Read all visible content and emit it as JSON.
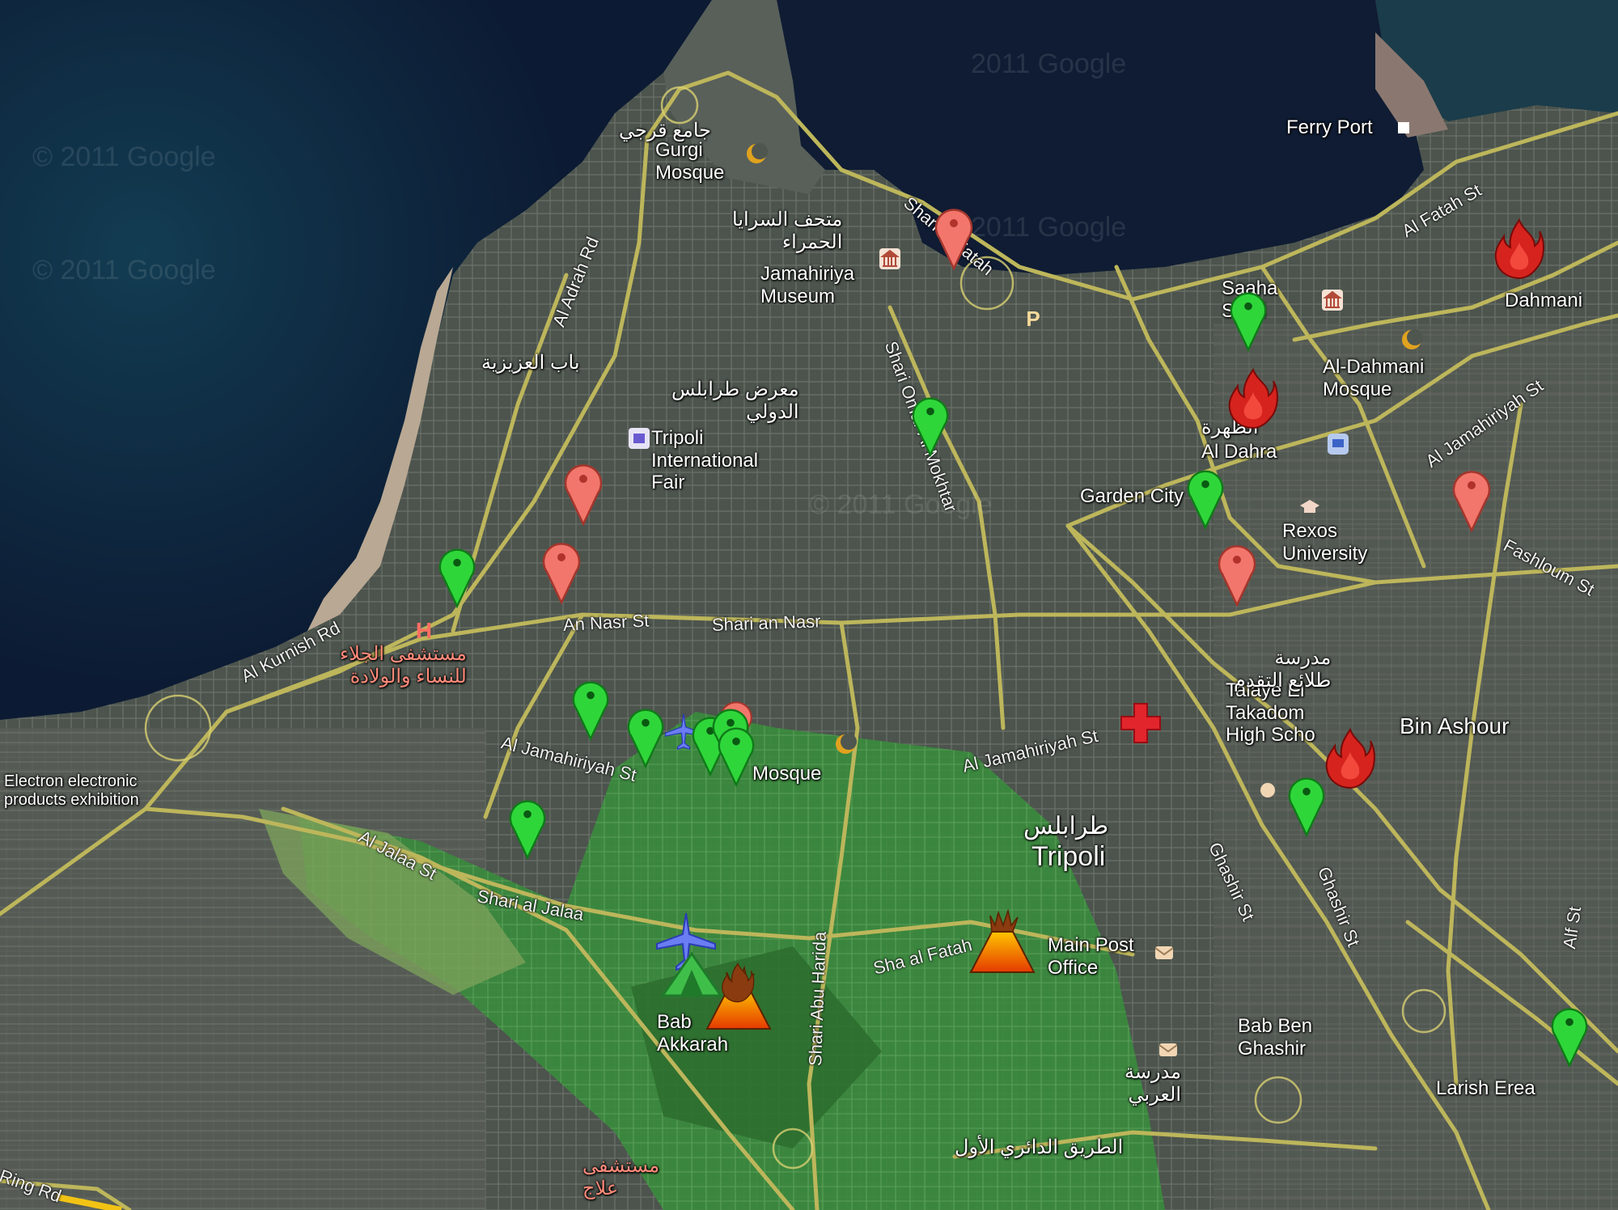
{
  "watermarks": [
    "© 2011 Google",
    "© 2011 Google",
    "© 2011 Google",
    "2011 Google",
    "2011 Google"
  ],
  "places": [
    {
      "text": "Gurgi\nMosque",
      "red": false
    },
    {
      "text": "Jamahiriya\nMuseum",
      "red": false
    },
    {
      "text": "Ferry Port",
      "red": false
    },
    {
      "text": "Tripoli\nInternational\nFair",
      "red": false
    },
    {
      "text": "Al Dahra",
      "red": false
    },
    {
      "text": "Garden City",
      "red": false
    },
    {
      "text": "Al-Dahmani\nMosque",
      "red": false
    },
    {
      "text": "Dahmani",
      "red": false
    },
    {
      "text": "Saaha\nSoufi",
      "red": false
    },
    {
      "text": "Rexos\nUniversity",
      "red": false
    },
    {
      "text": "Talaye El\nTakadom\nHigh Scho",
      "red": false
    },
    {
      "text": "Bin Ashour",
      "red": false
    },
    {
      "text": "Tripoli",
      "red": false
    },
    {
      "text": "Main Post\nOffice",
      "red": false
    },
    {
      "text": "Bab\nAkkarah",
      "red": false
    },
    {
      "text": "Bab Ben\nGhashir",
      "red": false
    },
    {
      "text": "Larish Erea",
      "red": false
    },
    {
      "text": "Electron electronic\nproducts exhibition",
      "red": false
    },
    {
      "text": "Mosque",
      "red": false
    },
    {
      "text": "جامع قرجي",
      "red": false
    },
    {
      "text": "متحف السرايا\nالحمراء",
      "red": false
    },
    {
      "text": "معرض طرابلس\nالدولي",
      "red": false
    },
    {
      "text": "مستشفى الجلاء\nللنساء والولادة",
      "red": true
    },
    {
      "text": "طرابلس",
      "red": false
    },
    {
      "text": "مدرسة\nطلائع التقدم",
      "red": false
    },
    {
      "text": "الظهرة",
      "red": false
    },
    {
      "text": "مستشفى\nعلاج",
      "red": true
    },
    {
      "text": "الطريق الدائري الأول",
      "red": false
    },
    {
      "text": "باب العزيزية",
      "red": false
    },
    {
      "text": "مدرسة\nالعربي",
      "red": false
    }
  ],
  "streets": [
    "Al Adrah Rd",
    "Al Kurnish Rd",
    "An Nasr St",
    "Shari an Nasr",
    "Al Jamahiriyah St",
    "Al Jamahiriyah St",
    "Al Jalaa St",
    "Shari al Jalaa",
    "Shari al Fatah",
    "Shari Omar Al Mokhtar",
    "Al Fatah St",
    "Al Jamahiriyah St",
    "Fashloum St",
    "Sha al Fatah",
    "Ghashir St",
    "Shari Abu Harida",
    "Alf St",
    "Ghashir St",
    "Ring Rd"
  ],
  "markers": {
    "green_count": 13,
    "red_count": 6,
    "fire_count": 4,
    "volcano_count": 2,
    "red_cross_count": 1
  },
  "colors": {
    "water": "#10203a",
    "land": "#4f5650",
    "road": "#b9b45a",
    "green_area": "#2f7a34",
    "green_marker": "#2fd63a",
    "red_marker": "#f0756a",
    "fire": "#d0201c",
    "volcano_top": "#ffb000",
    "volcano_bottom": "#e63c00"
  },
  "icons": [
    "mosque-icon",
    "museum-icon",
    "hospital-icon",
    "parking-icon",
    "airplane-icon",
    "camp-icon",
    "post-office-icon",
    "ferry-icon",
    "university-icon"
  ]
}
